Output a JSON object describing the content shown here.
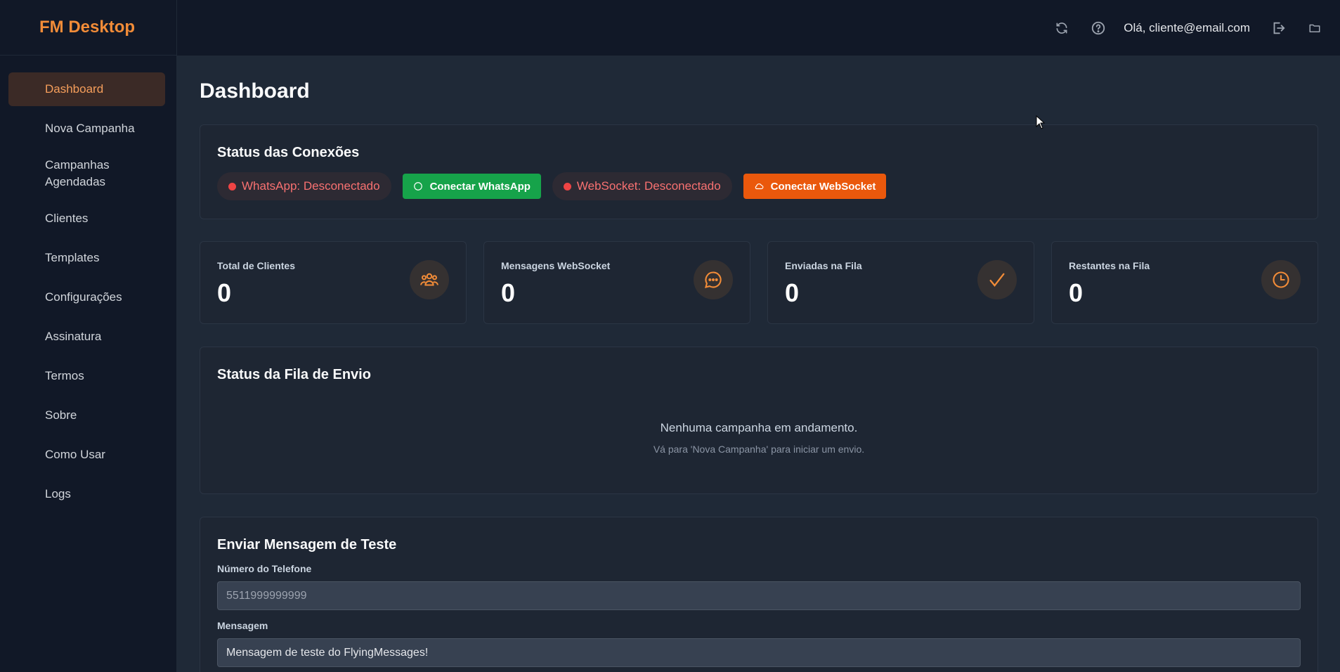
{
  "brand": "FM Desktop",
  "sidebar": {
    "items": [
      {
        "label": "Dashboard",
        "active": true
      },
      {
        "label": "Nova Campanha"
      },
      {
        "label": "Campanhas Agendadas"
      },
      {
        "label": "Clientes"
      },
      {
        "label": "Templates"
      },
      {
        "label": "Configurações"
      },
      {
        "label": "Assinatura"
      },
      {
        "label": "Termos"
      },
      {
        "label": "Sobre"
      },
      {
        "label": "Como Usar"
      },
      {
        "label": "Logs"
      }
    ]
  },
  "topbar": {
    "greeting": "Olá, cliente@email.com",
    "icons": [
      "refresh-icon",
      "help-icon",
      "logout-icon",
      "folder-icon"
    ]
  },
  "page_title": "Dashboard",
  "connections": {
    "title": "Status das Conexões",
    "whatsapp_status": "WhatsApp: Desconectado",
    "whatsapp_button": "Conectar WhatsApp",
    "websocket_status": "WebSocket: Desconectado",
    "websocket_button": "Conectar WebSocket"
  },
  "stats": [
    {
      "label": "Total de Clientes",
      "value": "0",
      "icon": "users-icon"
    },
    {
      "label": "Mensagens WebSocket",
      "value": "0",
      "icon": "chat-icon"
    },
    {
      "label": "Enviadas na Fila",
      "value": "0",
      "icon": "check-icon"
    },
    {
      "label": "Restantes na Fila",
      "value": "0",
      "icon": "clock-icon"
    }
  ],
  "queue": {
    "title": "Status da Fila de Envio",
    "empty_primary": "Nenhuma campanha em andamento.",
    "empty_secondary": "Vá para 'Nova Campanha' para iniciar um envio."
  },
  "test_message": {
    "title": "Enviar Mensagem de Teste",
    "phone_label": "Número do Telefone",
    "phone_placeholder": "5511999999999",
    "message_label": "Mensagem",
    "message_value": "Mensagem de teste do FlyingMessages!"
  },
  "colors": {
    "accent": "#f28c38",
    "danger": "#ef4444",
    "success": "#16a34a",
    "orange_button": "#ea580c"
  }
}
